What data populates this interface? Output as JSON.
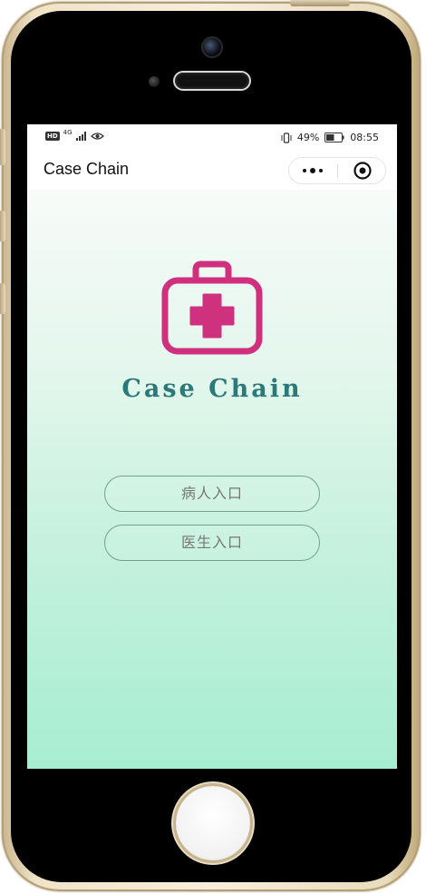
{
  "status_bar": {
    "hd": "HD",
    "network": "4G",
    "battery_percent": "49%",
    "time": "08:55"
  },
  "nav": {
    "title": "Case Chain",
    "more_icon": "more-dots-icon",
    "close_icon": "target-circle-icon"
  },
  "hero": {
    "logo_icon": "medical-kit-icon",
    "app_name": "Case Chain"
  },
  "buttons": {
    "patient_entry": "病人入口",
    "doctor_entry": "医生入口"
  },
  "colors": {
    "logo_magenta": "#d0317f",
    "title_teal": "#2b7a7a",
    "button_border": "#6ea58a",
    "gradient_bottom": "#a7edd2"
  }
}
